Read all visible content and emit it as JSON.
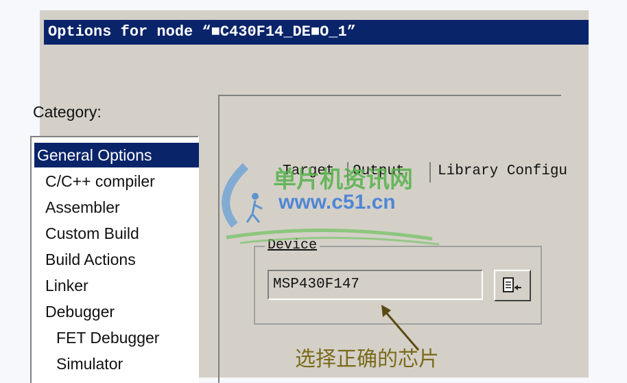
{
  "window": {
    "title": "Options for node “■C430F14_DE■O_1”"
  },
  "category": {
    "label": "Category:",
    "items": [
      {
        "label": "General Options",
        "selected": true,
        "indent": 0
      },
      {
        "label": "C/C++ compiler",
        "selected": false,
        "indent": 1
      },
      {
        "label": "Assembler",
        "selected": false,
        "indent": 1
      },
      {
        "label": "Custom Build",
        "selected": false,
        "indent": 1
      },
      {
        "label": "Build Actions",
        "selected": false,
        "indent": 1
      },
      {
        "label": "Linker",
        "selected": false,
        "indent": 1
      },
      {
        "label": "Debugger",
        "selected": false,
        "indent": 1
      },
      {
        "label": "FET Debugger",
        "selected": false,
        "indent": 2
      },
      {
        "label": "Simulator",
        "selected": false,
        "indent": 2
      }
    ]
  },
  "tabs": [
    "Target",
    "Output",
    "Library Configu"
  ],
  "device_group": {
    "title": "Device",
    "value": "MSP430F147",
    "button_icon": "device-select-icon"
  },
  "annotation": {
    "text": "选择正确的芯片"
  },
  "watermark": {
    "line1": "单片机资讯网",
    "line2": "www.c51.cn"
  },
  "colors": {
    "title_bar": "#0a246a",
    "dialog_bg": "#d4d0c8",
    "annotation": "#7a6a1a"
  }
}
